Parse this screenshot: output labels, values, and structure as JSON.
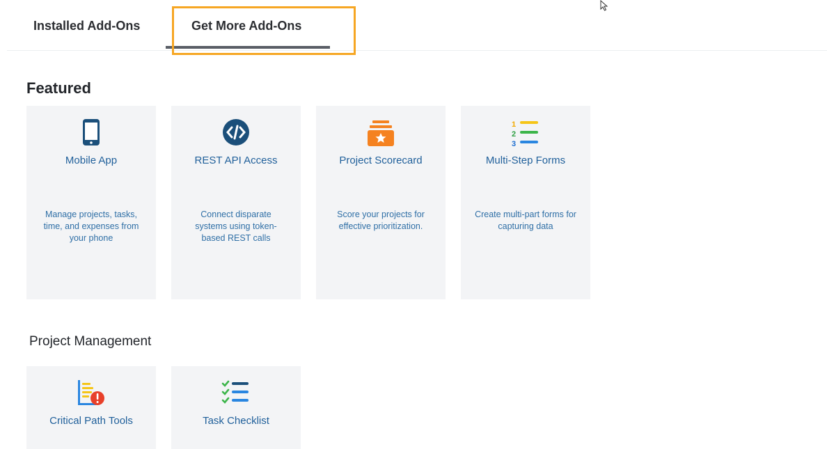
{
  "tabs": {
    "installed": "Installed Add-Ons",
    "get_more": "Get More Add-Ons"
  },
  "sections": {
    "featured": "Featured",
    "project_management": "Project Management"
  },
  "featured_cards": [
    {
      "title": "Mobile App",
      "description": "Manage projects, tasks, time, and expenses from your phone",
      "icon": "mobile-phone-icon"
    },
    {
      "title": "REST API Access",
      "description": "Connect disparate systems using token-based REST calls",
      "icon": "code-icon"
    },
    {
      "title": "Project Scorecard",
      "description": "Score your projects for effective prioritization.",
      "icon": "scorecard-icon"
    },
    {
      "title": "Multi-Step Forms",
      "description": "Create multi-part forms for capturing data",
      "icon": "numbered-list-icon"
    }
  ],
  "pm_cards": [
    {
      "title": "Critical Path Tools",
      "icon": "critical-path-icon"
    },
    {
      "title": "Task Checklist",
      "icon": "checklist-icon"
    }
  ],
  "colors": {
    "highlight": "#f6a623",
    "title_blue": "#1f5f9a",
    "card_bg": "#f3f4f6"
  }
}
